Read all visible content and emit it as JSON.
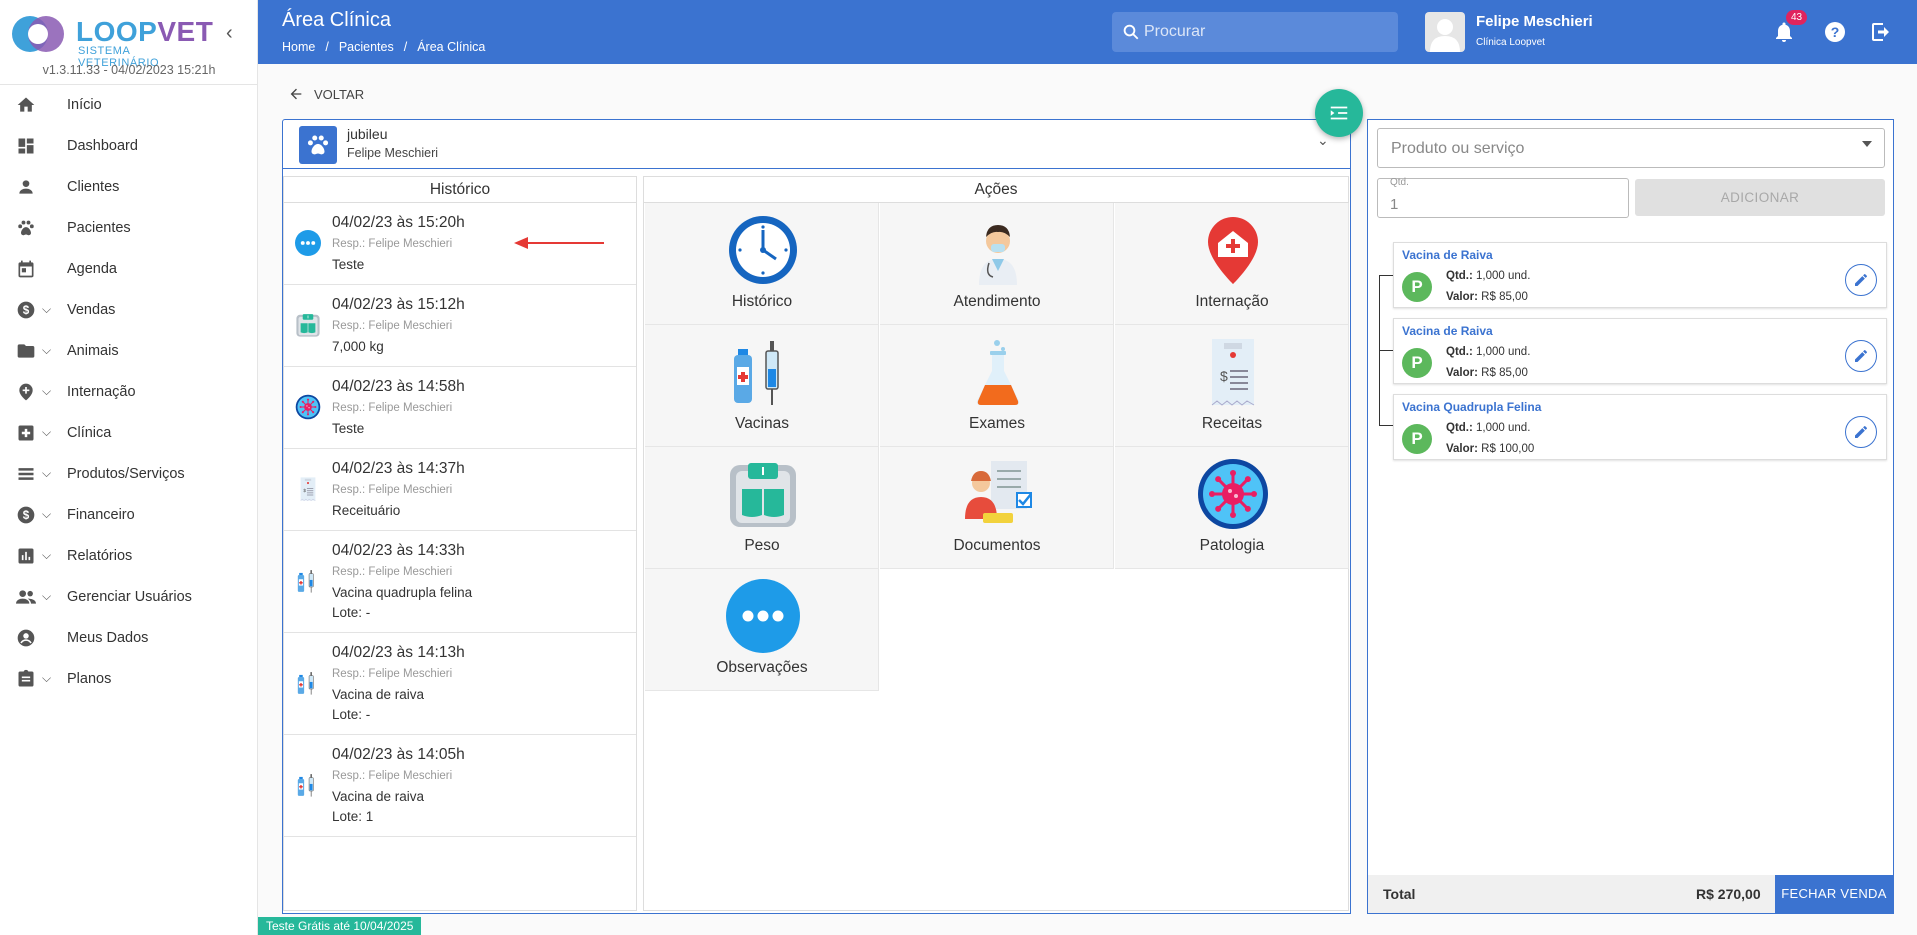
{
  "sidebar": {
    "logo_loop": "LOOP",
    "logo_vet": "VET",
    "logo_sub": "SISTEMA VETERINÁRIO",
    "version": "v1.3.11.33 - 04/02/2023 15:21h",
    "items": [
      {
        "label": "Início",
        "icon": "home-icon"
      },
      {
        "label": "Dashboard",
        "icon": "dashboard-icon"
      },
      {
        "label": "Clientes",
        "icon": "person-icon"
      },
      {
        "label": "Pacientes",
        "icon": "paw-icon"
      },
      {
        "label": "Agenda",
        "icon": "calendar-icon"
      },
      {
        "label": "Vendas",
        "icon": "dollar-icon",
        "expandable": true
      },
      {
        "label": "Animais",
        "icon": "folder-icon",
        "expandable": true
      },
      {
        "label": "Internação",
        "icon": "pin-cross-icon",
        "expandable": true
      },
      {
        "label": "Clínica",
        "icon": "medical-box-icon",
        "expandable": true
      },
      {
        "label": "Produtos/Serviços",
        "icon": "list-icon",
        "expandable": true
      },
      {
        "label": "Financeiro",
        "icon": "dollar-icon",
        "expandable": true
      },
      {
        "label": "Relatórios",
        "icon": "bar-chart-icon",
        "expandable": true
      },
      {
        "label": "Gerenciar Usuários",
        "icon": "group-icon",
        "expandable": true
      },
      {
        "label": "Meus Dados",
        "icon": "account-circle-icon"
      },
      {
        "label": "Planos",
        "icon": "clipboard-icon",
        "expandable": true
      }
    ],
    "trial": "Teste Grátis até 10/04/2025"
  },
  "header": {
    "title": "Área Clínica",
    "breadcrumb": [
      "Home",
      "/",
      "Pacientes",
      "/",
      "Área Clínica"
    ],
    "search_placeholder": "Procurar",
    "user_name": "Felipe Meschieri",
    "user_clinic": "Clínica Loopvet",
    "notifications": "43"
  },
  "main": {
    "back_label": "VOLTAR",
    "patient": {
      "name": "jubileu",
      "owner": "Felipe Meschieri"
    },
    "historico_title": "Histórico",
    "acoes_title": "Ações",
    "history": [
      {
        "date": "04/02/23 às 15:20h",
        "resp": "Resp.: Felipe Meschieri",
        "desc": "Teste",
        "lote": "",
        "icon": "observation-icon"
      },
      {
        "date": "04/02/23 às 15:12h",
        "resp": "Resp.: Felipe Meschieri",
        "desc": "7,000 kg",
        "lote": "",
        "icon": "scale-icon"
      },
      {
        "date": "04/02/23 às 14:58h",
        "resp": "Resp.: Felipe Meschieri",
        "desc": "Teste",
        "lote": "",
        "icon": "virus-icon"
      },
      {
        "date": "04/02/23 às 14:37h",
        "resp": "Resp.: Felipe Meschieri",
        "desc": "Receituário",
        "lote": "",
        "icon": "receipt-icon"
      },
      {
        "date": "04/02/23 às 14:33h",
        "resp": "Resp.: Felipe Meschieri",
        "desc": "Vacina quadrupla felina",
        "lote": "Lote: -",
        "icon": "vaccine-icon"
      },
      {
        "date": "04/02/23 às 14:13h",
        "resp": "Resp.: Felipe Meschieri",
        "desc": "Vacina de raiva",
        "lote": "Lote: -",
        "icon": "vaccine-icon"
      },
      {
        "date": "04/02/23 às 14:05h",
        "resp": "Resp.: Felipe Meschieri",
        "desc": "Vacina de raiva",
        "lote": "Lote: 1",
        "icon": "vaccine-icon"
      }
    ],
    "actions": [
      {
        "label": "Histórico",
        "icon": "clock-icon"
      },
      {
        "label": "Atendimento",
        "icon": "doctor-icon"
      },
      {
        "label": "Internação",
        "icon": "hospital-pin-icon"
      },
      {
        "label": "Vacinas",
        "icon": "vaccine-icon"
      },
      {
        "label": "Exames",
        "icon": "flask-icon"
      },
      {
        "label": "Receitas",
        "icon": "receipt-icon"
      },
      {
        "label": "Peso",
        "icon": "scale-icon"
      },
      {
        "label": "Documentos",
        "icon": "documents-icon"
      },
      {
        "label": "Patologia",
        "icon": "virus-icon"
      },
      {
        "label": "Observações",
        "icon": "observation-icon"
      }
    ]
  },
  "cart": {
    "product_placeholder": "Produto ou serviço",
    "qty_label": "Qtd.",
    "qty_value": "1",
    "add_label": "ADICIONAR",
    "items": [
      {
        "title": "Vacina de Raiva",
        "badge": "P",
        "qtd_label": "Qtd.:",
        "qtd": "1,000 und.",
        "valor_label": "Valor:",
        "valor": "R$ 85,00"
      },
      {
        "title": "Vacina de Raiva",
        "badge": "P",
        "qtd_label": "Qtd.:",
        "qtd": "1,000 und.",
        "valor_label": "Valor:",
        "valor": "R$ 85,00"
      },
      {
        "title": "Vacina Quadrupla Felina",
        "badge": "P",
        "qtd_label": "Qtd.:",
        "qtd": "1,000 und.",
        "valor_label": "Valor:",
        "valor": "R$ 100,00"
      }
    ],
    "total_label": "Total",
    "total_value": "R$ 270,00",
    "close_label": "FECHAR VENDA"
  },
  "colors": {
    "primary": "#3b73d0",
    "teal": "#26b89a",
    "green": "#5cb85c",
    "badge": "#e0245e"
  }
}
